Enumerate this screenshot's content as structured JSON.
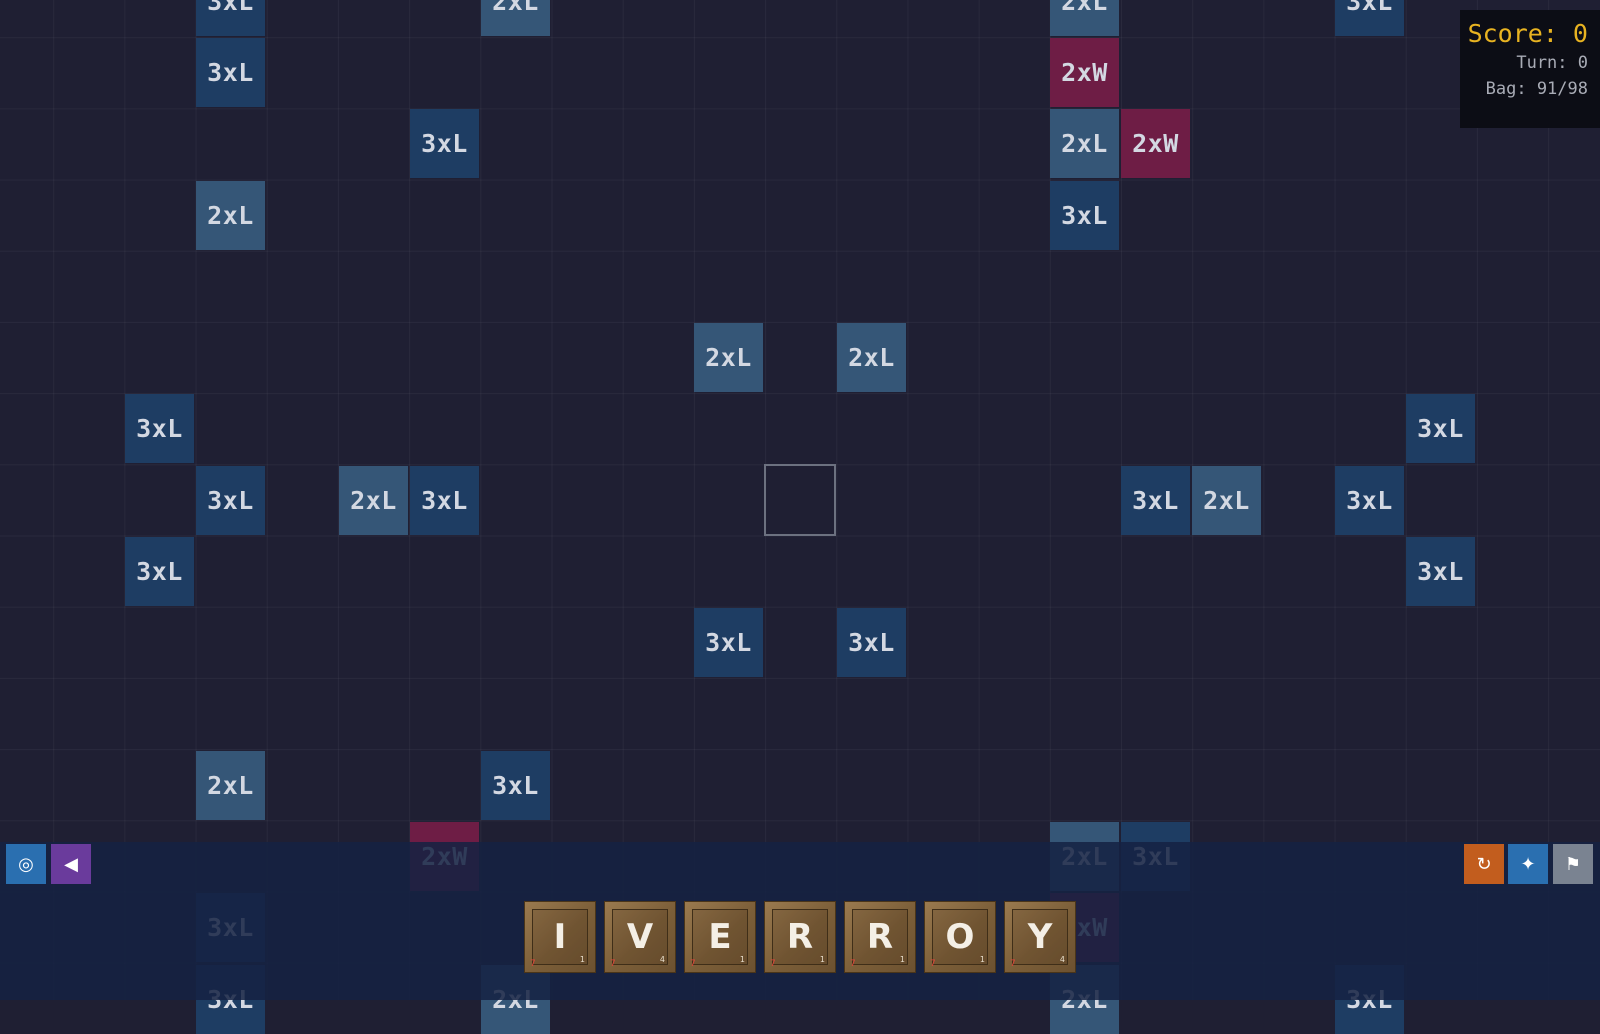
{
  "colors": {
    "background": "#1f1f33",
    "triple_letter": "#1e3d63",
    "double_letter": "#355677",
    "double_word": "#6e1d45",
    "score_text": "#e8b321",
    "bottom_bar": "#152242",
    "tile_wood": "#8a6a42"
  },
  "board": {
    "premium_labels": {
      "triple_letter": "3xL",
      "double_letter": "2xL",
      "double_word": "2xW"
    }
  },
  "score_panel": {
    "score": "Score: 0",
    "turn": "Turn: 0",
    "bag": "Bag: 91/98"
  },
  "toolbar": {
    "left_buttons": [
      {
        "icon": "target-icon",
        "glyph": "◎"
      },
      {
        "icon": "back-arrow-icon",
        "glyph": "◀"
      }
    ],
    "right_buttons": [
      {
        "icon": "refresh-icon",
        "glyph": "↻"
      },
      {
        "icon": "sparkle-icon",
        "glyph": "✦"
      },
      {
        "icon": "flag-icon",
        "glyph": "⚑"
      }
    ]
  },
  "rack": {
    "tiles": [
      {
        "letter": "I",
        "count": "7",
        "value": "1"
      },
      {
        "letter": "V",
        "count": "7",
        "value": "4"
      },
      {
        "letter": "E",
        "count": "7",
        "value": "1"
      },
      {
        "letter": "R",
        "count": "7",
        "value": "1"
      },
      {
        "letter": "R",
        "count": "7",
        "value": "1"
      },
      {
        "letter": "O",
        "count": "7",
        "value": "1"
      },
      {
        "letter": "Y",
        "count": "7",
        "value": "4"
      }
    ]
  }
}
